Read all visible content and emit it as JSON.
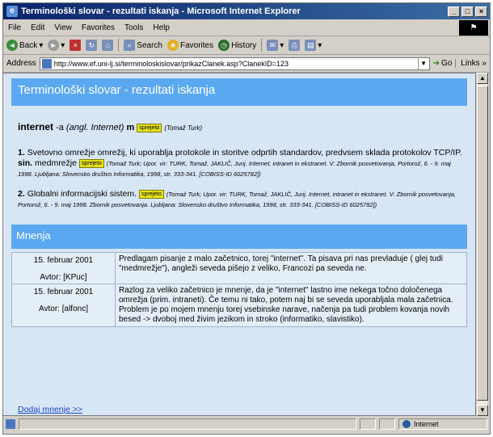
{
  "window": {
    "title": "Terminološki slovar - rezultati iskanja - Microsoft Internet Explorer",
    "min_label": "_",
    "max_label": "□",
    "close_label": "×",
    "brand_glyph": "⚑"
  },
  "menu": [
    "File",
    "Edit",
    "View",
    "Favorites",
    "Tools",
    "Help"
  ],
  "toolbar": {
    "back": "Back",
    "search": "Search",
    "favorites": "Favorites",
    "history": "History"
  },
  "address": {
    "label": "Address",
    "url": "http://www.ef.uni-lj.si/terminoloskislovar/prikazClanek.asp?ClanekID=123",
    "go": "Go",
    "links": "Links"
  },
  "page": {
    "title": "Terminološki slovar - rezultati iskanja",
    "term": "internet",
    "term_suffix": " -a",
    "term_origin": "(angl. Internet)",
    "term_gender": "m",
    "badge": "sprejeto",
    "term_author": "(Tomaž Turk)",
    "definitions": [
      {
        "num": "1.",
        "text": "Svetovno omrežje omrežij, ki uporablja protokole in storitve odprtih standardov, predvsem sklada protokolov TCP/IP.",
        "syn_label": "sin.",
        "syn": "medmrežje",
        "ref": "(Tomaž Turk; Upor. vir: TURK, Tomaž, JAKLIČ, Jurij. Internet, intranet in ekstranet. V: Zbornik posvetovanja, Portorož, 6. - 9. maj 1998. Ljubljana: Slovensko društvo Informatika, 1998, str. 333-341. [COBISS-ID 6025782])"
      },
      {
        "num": "2.",
        "text": "Globalni informacijski sistem.",
        "ref": "(Tomaž Turk; Upor. vir: TURK, Tomaž, JAKLIČ, Jurij. Internet, intranet in ekstranet. V: Zbornik posvetovanja, Portorož, 6. - 9. maj 1998. Zbornik posvetovanja. Ljubljana: Slovensko društvo Informatika, 1998, str. 333-341. [COBISS-ID 6025782])"
      }
    ],
    "opinions_title": "Mnenja",
    "comments": [
      {
        "date": "15. februar 2001",
        "author": "Avtor: [KPuc]",
        "text": "Predlagam pisanje z malo začetnico, torej \"internet\". Ta pisava pri nas prevladuje ( glej tudi \"medmrežje\"), angleži seveda pišejo z veliko, Francozi pa seveda ne."
      },
      {
        "date": "15. februar 2001",
        "author": "Avtor: [alfonc]",
        "text": "Razlog za veliko začetnico je mnenje, da je \"internet\" lastno ime nekega točno določenega omrežja (prim. intraneti). Če temu ni tako, potem naj bi se seveda uporabljala mala začetnica. Problem je po mojem mnenju torej vsebinske narave, načenja pa tudi problem kovanja novih besed -> dvoboj med živim jezikom in stroko (informatiko, slavistiko)."
      }
    ],
    "add_opinion": "Dodaj mnenje >>"
  },
  "status": {
    "zone": "Internet"
  },
  "colors": {
    "header_blue": "#5aa8f0",
    "page_bg": "#d7e6f5",
    "badge_yellow": "#e6e020"
  }
}
